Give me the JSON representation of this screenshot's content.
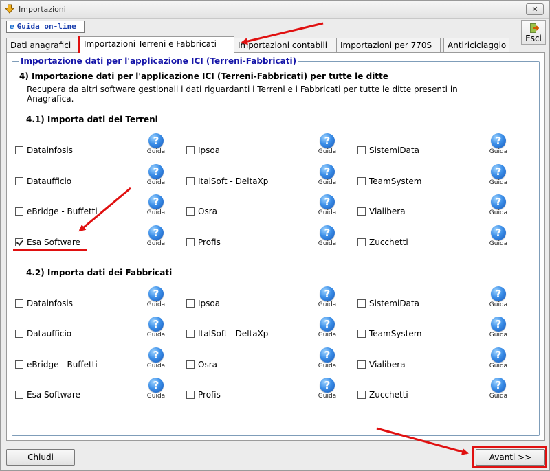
{
  "window": {
    "title": "Importazioni",
    "close_label": "✕"
  },
  "toolbar": {
    "guida_online": "Guida on-line",
    "esci": "Esci"
  },
  "tabs": [
    {
      "label": "Dati anagrafici"
    },
    {
      "label": "Importazioni Terreni e Fabbricati"
    },
    {
      "label": "Importazioni contabili"
    },
    {
      "label": "Importazioni per 770S"
    },
    {
      "label": "Antiriciclaggio"
    }
  ],
  "group": {
    "title": "Importazione dati per l'applicazione ICI (Terreni-Fabbricati)",
    "heading": "4) Importazione dati per l'applicazione ICI (Terreni-Fabbricati) per tutte le ditte",
    "description": "Recupera da altri software gestionali i dati riguardanti i Terreni e i Fabbricati per tutte le ditte presenti in Anagrafica."
  },
  "help_label": "Guida",
  "help_symbol": "?",
  "sections": [
    {
      "title": "4.1) Importa dati dei Terreni",
      "options": [
        {
          "label": "Datainfosis",
          "checked": false
        },
        {
          "label": "Ipsoa",
          "checked": false
        },
        {
          "label": "SistemiData",
          "checked": false
        },
        {
          "label": "Dataufficio",
          "checked": false
        },
        {
          "label": "ItalSoft - DeltaXp",
          "checked": false
        },
        {
          "label": "TeamSystem",
          "checked": false
        },
        {
          "label": "eBridge - Buffetti",
          "checked": false
        },
        {
          "label": "Osra",
          "checked": false
        },
        {
          "label": "Vialibera",
          "checked": false
        },
        {
          "label": "Esa Software",
          "checked": true
        },
        {
          "label": "Profis",
          "checked": false
        },
        {
          "label": "Zucchetti",
          "checked": false
        }
      ]
    },
    {
      "title": "4.2) Importa dati dei Fabbricati",
      "options": [
        {
          "label": "Datainfosis",
          "checked": false
        },
        {
          "label": "Ipsoa",
          "checked": false
        },
        {
          "label": "SistemiData",
          "checked": false
        },
        {
          "label": "Dataufficio",
          "checked": false
        },
        {
          "label": "ItalSoft - DeltaXp",
          "checked": false
        },
        {
          "label": "TeamSystem",
          "checked": false
        },
        {
          "label": "eBridge - Buffetti",
          "checked": false
        },
        {
          "label": "Osra",
          "checked": false
        },
        {
          "label": "Vialibera",
          "checked": false
        },
        {
          "label": "Esa Software",
          "checked": false
        },
        {
          "label": "Profis",
          "checked": false
        },
        {
          "label": "Zucchetti",
          "checked": false
        }
      ]
    }
  ],
  "footer": {
    "chiudi": "Chiudi",
    "avanti": "Avanti >>"
  },
  "colors": {
    "annotation": "#e01010",
    "group_title": "#1515a8",
    "accent": "#1a3fae"
  }
}
